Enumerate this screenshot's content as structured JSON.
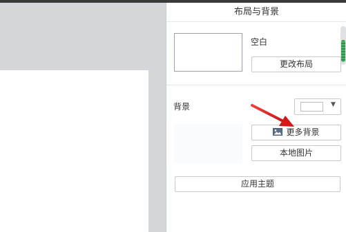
{
  "panel": {
    "title": "布局与背景",
    "layout": {
      "name": "空白",
      "change_button": "更改布局"
    },
    "background": {
      "label": "背景",
      "color_value": "#ffffff",
      "more_button": "更多背景",
      "more_button_icon": "image-icon",
      "local_button": "本地图片"
    },
    "apply_theme_button": "应用主题"
  },
  "colors": {
    "annotation_arrow": "#e02020",
    "scroll_thumb": "#3aa65a"
  }
}
